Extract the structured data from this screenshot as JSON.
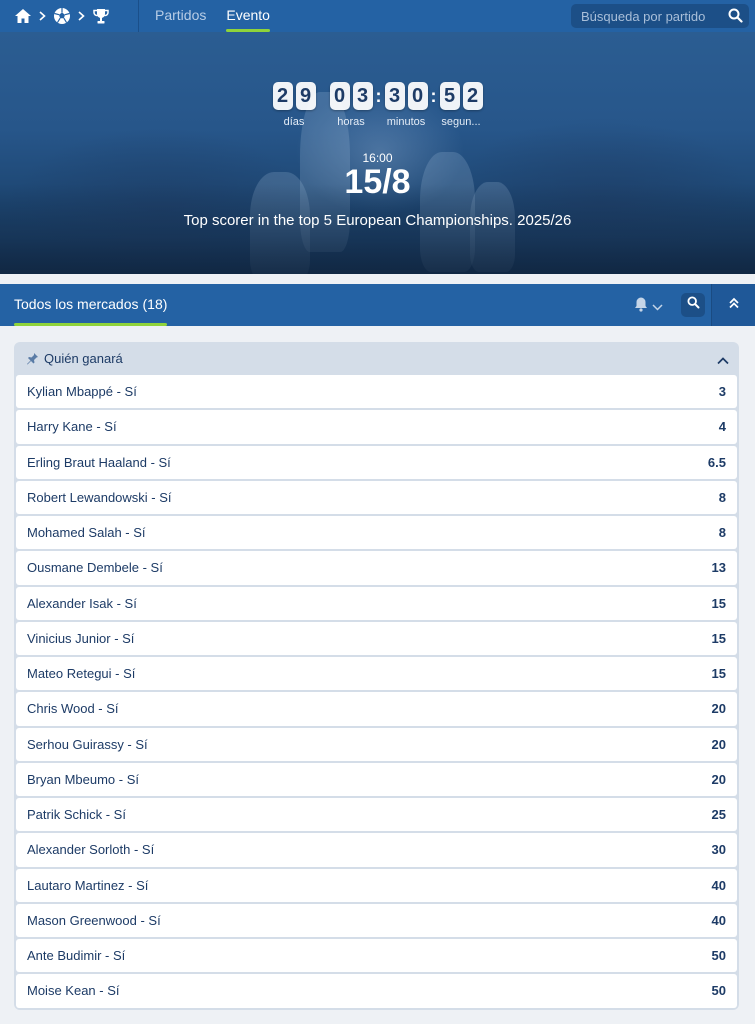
{
  "nav": {
    "crumbs": [
      {
        "icon": "home-icon"
      },
      {
        "icon": "soccer-ball-icon"
      },
      {
        "icon": "trophy-icon"
      }
    ],
    "tabs": [
      "Partidos",
      "Evento"
    ],
    "active_tab": "Evento",
    "search_placeholder": "Búsqueda por partido"
  },
  "hero": {
    "countdown": {
      "days": "29",
      "hours": "03",
      "minutes": "30",
      "seconds": "52",
      "labels": {
        "days": "días",
        "hours": "horas",
        "minutes": "minutos",
        "seconds": "segun..."
      }
    },
    "time": "16:00",
    "date": "15/8",
    "title": "Top scorer in the top 5 European Championships. 2025/26"
  },
  "markets": {
    "tab_label": "Todos los mercados",
    "count": "(18)"
  },
  "market": {
    "title": "Quién ganará",
    "selections": [
      {
        "name": "Kylian Mbappé - Sí",
        "odd": "3"
      },
      {
        "name": "Harry Kane - Sí",
        "odd": "4"
      },
      {
        "name": "Erling Braut Haaland - Sí",
        "odd": "6.5"
      },
      {
        "name": "Robert Lewandowski - Sí",
        "odd": "8"
      },
      {
        "name": "Mohamed Salah - Sí",
        "odd": "8"
      },
      {
        "name": "Ousmane Dembele - Sí",
        "odd": "13"
      },
      {
        "name": "Alexander Isak - Sí",
        "odd": "15"
      },
      {
        "name": "Vinicius Junior - Sí",
        "odd": "15"
      },
      {
        "name": "Mateo Retegui - Sí",
        "odd": "15"
      },
      {
        "name": "Chris Wood - Sí",
        "odd": "20"
      },
      {
        "name": "Serhou Guirassy - Sí",
        "odd": "20"
      },
      {
        "name": "Bryan Mbeumo - Sí",
        "odd": "20"
      },
      {
        "name": "Patrik Schick - Sí",
        "odd": "25"
      },
      {
        "name": "Alexander Sorloth - Sí",
        "odd": "30"
      },
      {
        "name": "Lautaro Martinez - Sí",
        "odd": "40"
      },
      {
        "name": "Mason Greenwood - Sí",
        "odd": "40"
      },
      {
        "name": "Ante Budimir - Sí",
        "odd": "50"
      },
      {
        "name": "Moise Kean - Sí",
        "odd": "50"
      }
    ]
  },
  "colors": {
    "nav_blue": "#2462a4",
    "accent_green": "#8fd33a",
    "text_navy": "#1d3b66"
  }
}
